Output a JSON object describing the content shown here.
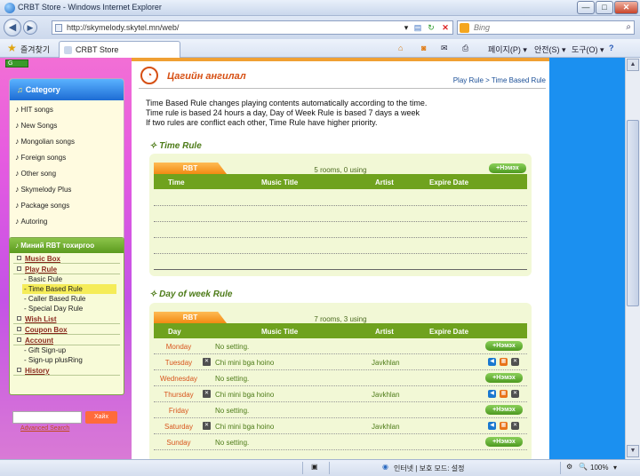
{
  "window": {
    "title": "CRBT Store - Windows Internet Explorer",
    "min": "—",
    "max": "□",
    "close": "✕"
  },
  "address": {
    "url": "http://skymelody.skytel.mn/web/",
    "search_placeholder": "Bing"
  },
  "favorites": {
    "label": "즐겨찾기",
    "tab_label": "CRBT Store"
  },
  "toolbar": {
    "page": "페이지(P) ▾",
    "safety": "안전(S) ▾",
    "tools": "도구(O) ▾",
    "help": "?"
  },
  "sidebar": {
    "dropdown": "G",
    "category_title": "Category",
    "categories": [
      "HIT songs",
      "New Songs",
      "Mongolian songs",
      "Foreign songs",
      "Other song",
      "Skymelody Plus",
      "Package songs",
      "Autoring"
    ],
    "rbt_title": "Миний RBT тохиргоо",
    "rbt_sections": {
      "music_box": "Music Box",
      "play_rule": "Play Rule",
      "play_rule_items": [
        "- Basic Rule",
        "- Time Based Rule",
        "- Caller Based Rule",
        "- Special Day Rule"
      ],
      "wish_list": "Wish List",
      "coupon_box": "Coupon Box",
      "account": "Account",
      "account_items": [
        "- Gift Sign-up",
        "- Sign-up plusRing"
      ],
      "history": "History"
    },
    "search_button": "Хайх",
    "advanced_search": "Advanced Search"
  },
  "main": {
    "title": "Цагийн ангилал",
    "breadcrumb": "Play Rule > Time Based Rule",
    "intro": [
      "Time Based Rule changes playing contents automatically according to the time.",
      "Time rule is based 24 hours a day, Day of Week Rule is based 7 days a week",
      "If two rules are conflict each other, Time Rule have higher priority."
    ],
    "time_rule": {
      "title": "✧ Time Rule",
      "tab": "RBT",
      "rooms": "5 rooms, 0 using",
      "add": "+Нэмэх",
      "columns": [
        "Time",
        "Music Title",
        "Artist",
        "Expire Date"
      ]
    },
    "dow_rule": {
      "title": "✧ Day of week Rule",
      "tab": "RBT",
      "rooms": "7 rooms, 3 using",
      "add": "+Нэмэх",
      "columns": [
        "Day",
        "Music Title",
        "Artist",
        "Expire Date"
      ],
      "rows": [
        {
          "day": "Monday",
          "title": "No setting.",
          "artist": "",
          "set": false
        },
        {
          "day": "Tuesday",
          "title": "Chi mini bga hoino",
          "artist": "Javkhlan",
          "set": true
        },
        {
          "day": "Wednesday",
          "title": "No setting.",
          "artist": "",
          "set": false
        },
        {
          "day": "Thursday",
          "title": "Chi mini bga hoino",
          "artist": "Javkhlan",
          "set": true
        },
        {
          "day": "Friday",
          "title": "No setting.",
          "artist": "",
          "set": false
        },
        {
          "day": "Saturday",
          "title": "Chi mini bga hoino",
          "artist": "Javkhlan",
          "set": true
        },
        {
          "day": "Sunday",
          "title": "No setting.",
          "artist": "",
          "set": false
        }
      ]
    }
  },
  "status": {
    "zone": "인터넷 | 보호 모드: 설정",
    "zoom": "100%"
  },
  "colors": {
    "accent_orange": "#d64f13",
    "green_header": "#6fa21e",
    "sidebar_pink": "#e65be0",
    "right_blue": "#1b90f0"
  }
}
